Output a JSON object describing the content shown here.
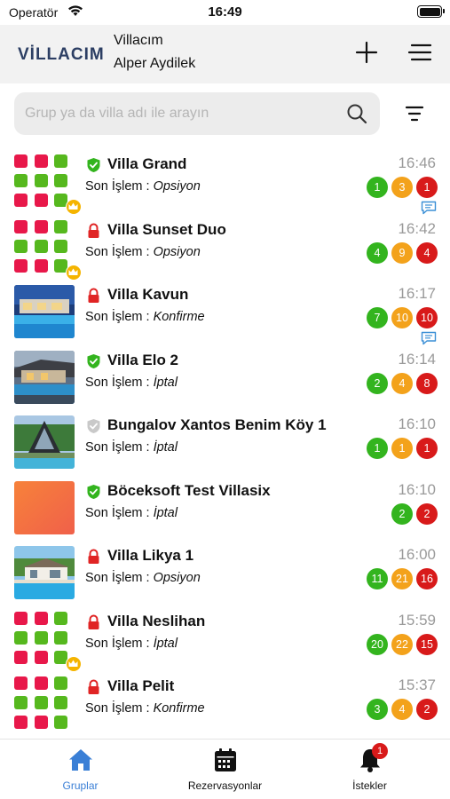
{
  "status_bar": {
    "carrier": "Operatör",
    "time": "16:49"
  },
  "header": {
    "logo": "VİLLACIM",
    "title": "Villacım",
    "user": "Alper Aydilek"
  },
  "search": {
    "placeholder": "Grup ya da villa adı ile arayın",
    "value": ""
  },
  "last_op_label": "Son İşlem :",
  "colors": {
    "green": "#33b41e",
    "orange": "#f3a21b",
    "red": "#d81a1a",
    "active_tab": "#3a7fd6"
  },
  "villas": [
    {
      "name": "Villa Grand",
      "status_icon": "shield-check",
      "last_op": "Opsiyon",
      "time": "16:46",
      "thumb": "grid",
      "crown": true,
      "badges": [
        {
          "v": "1",
          "c": "green"
        },
        {
          "v": "3",
          "c": "orange"
        },
        {
          "v": "1",
          "c": "red"
        }
      ],
      "chat": true
    },
    {
      "name": "Villa Sunset Duo",
      "status_icon": "lock",
      "last_op": "Opsiyon",
      "time": "16:42",
      "thumb": "grid",
      "crown": true,
      "badges": [
        {
          "v": "4",
          "c": "green"
        },
        {
          "v": "9",
          "c": "orange"
        },
        {
          "v": "4",
          "c": "red"
        }
      ],
      "chat": false
    },
    {
      "name": "Villa Kavun",
      "status_icon": "lock",
      "last_op": "Konfirme",
      "time": "16:17",
      "thumb": "photo-pool-night",
      "crown": false,
      "badges": [
        {
          "v": "7",
          "c": "green"
        },
        {
          "v": "10",
          "c": "orange"
        },
        {
          "v": "10",
          "c": "red"
        }
      ],
      "chat": true
    },
    {
      "name": "Villa Elo 2",
      "status_icon": "shield-check",
      "last_op": "İptal",
      "time": "16:14",
      "thumb": "photo-villa-dusk",
      "crown": false,
      "badges": [
        {
          "v": "2",
          "c": "green"
        },
        {
          "v": "4",
          "c": "orange"
        },
        {
          "v": "8",
          "c": "red"
        }
      ],
      "chat": false
    },
    {
      "name": "Bungalov Xantos Benim Köy 1",
      "status_icon": "shield-grey",
      "last_op": "İptal",
      "time": "16:10",
      "thumb": "photo-a-frame",
      "crown": false,
      "badges": [
        {
          "v": "1",
          "c": "green"
        },
        {
          "v": "1",
          "c": "orange"
        },
        {
          "v": "1",
          "c": "red"
        }
      ],
      "chat": false
    },
    {
      "name": "Böceksoft Test Villasix",
      "status_icon": "shield-check",
      "last_op": "İptal",
      "time": "16:10",
      "thumb": "orange-gradient",
      "crown": false,
      "badges": [
        {
          "v": "2",
          "c": "green"
        },
        {
          "v": "2",
          "c": "red"
        }
      ],
      "chat": false
    },
    {
      "name": "Villa Likya 1",
      "status_icon": "lock",
      "last_op": "Opsiyon",
      "time": "16:00",
      "thumb": "photo-villa-day",
      "crown": false,
      "badges": [
        {
          "v": "11",
          "c": "green"
        },
        {
          "v": "21",
          "c": "orange"
        },
        {
          "v": "16",
          "c": "red"
        }
      ],
      "chat": false
    },
    {
      "name": "Villa Neslihan",
      "status_icon": "lock",
      "last_op": "İptal",
      "time": "15:59",
      "thumb": "grid",
      "crown": true,
      "badges": [
        {
          "v": "20",
          "c": "green"
        },
        {
          "v": "22",
          "c": "orange"
        },
        {
          "v": "15",
          "c": "red"
        }
      ],
      "chat": false
    },
    {
      "name": "Villa Pelit",
      "status_icon": "lock",
      "last_op": "Konfirme",
      "time": "15:37",
      "thumb": "grid",
      "crown": false,
      "badges": [
        {
          "v": "3",
          "c": "green"
        },
        {
          "v": "4",
          "c": "orange"
        },
        {
          "v": "2",
          "c": "red"
        }
      ],
      "chat": false
    }
  ],
  "tabs": [
    {
      "label": "Gruplar",
      "icon": "home-icon",
      "active": true
    },
    {
      "label": "Rezervasyonlar",
      "icon": "calendar-icon",
      "active": false
    },
    {
      "label": "İstekler",
      "icon": "bell-icon",
      "active": false,
      "badge": "1"
    }
  ]
}
